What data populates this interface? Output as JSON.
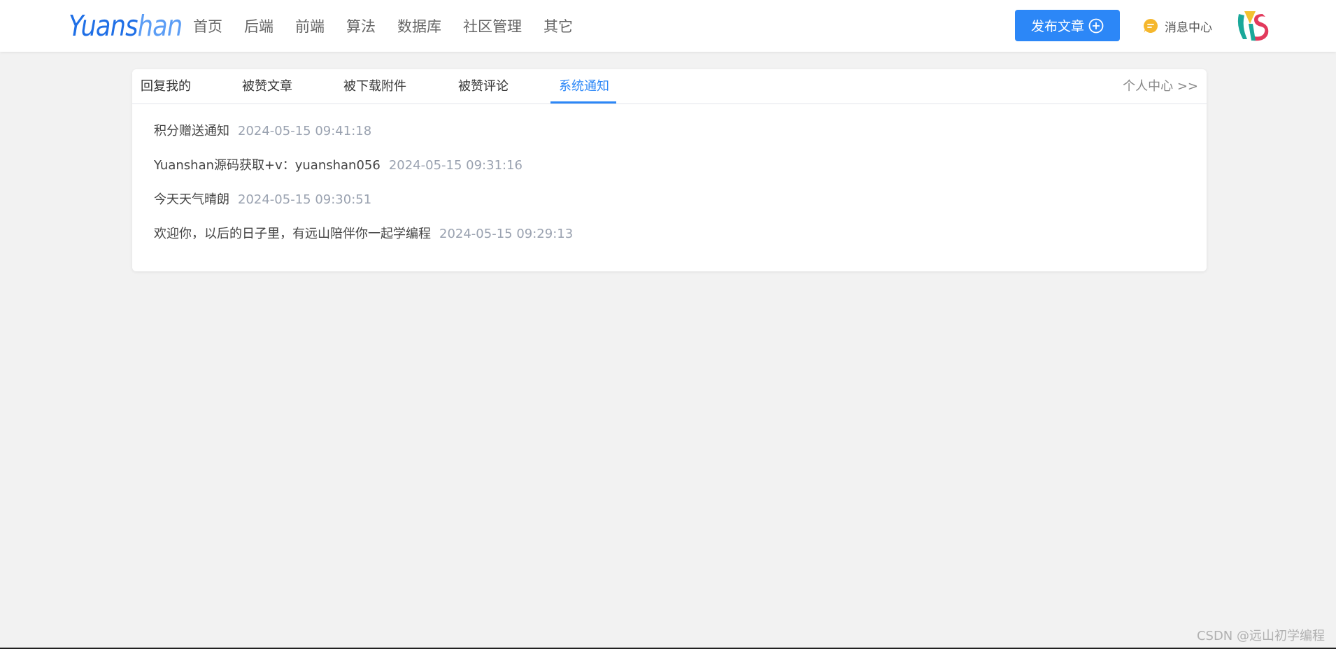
{
  "header": {
    "logo_part1": "Yuans",
    "logo_part2": "han",
    "nav": [
      "首页",
      "后端",
      "前端",
      "算法",
      "数据库",
      "社区管理",
      "其它"
    ],
    "publish_label": "发布文章",
    "message_center_label": "消息中心",
    "avatar_letters": "YS"
  },
  "tabs": {
    "items": [
      "回复我的",
      "被赞文章",
      "被下载附件",
      "被赞评论",
      "系统通知"
    ],
    "active": "系统通知",
    "personal_center": "个人中心 >>"
  },
  "notifications": [
    {
      "title": "积分赠送通知",
      "time": "2024-05-15 09:41:18"
    },
    {
      "title": "Yuanshan源码获取+v：yuanshan056",
      "time": "2024-05-15 09:31:16"
    },
    {
      "title": "今天天气晴朗",
      "time": "2024-05-15 09:30:51"
    },
    {
      "title": "欢迎你，以后的日子里，有远山陪伴你一起学编程",
      "time": "2024-05-15 09:29:13"
    }
  ],
  "watermark": "CSDN @远山初学编程",
  "colors": {
    "accent": "#2c87f7",
    "background": "#f2f2f2",
    "time_text": "#9aa2b0",
    "message_icon": "#f5b72d"
  },
  "icons": {
    "publish": "plus-circle-icon",
    "message": "chat-bubble-icon"
  }
}
